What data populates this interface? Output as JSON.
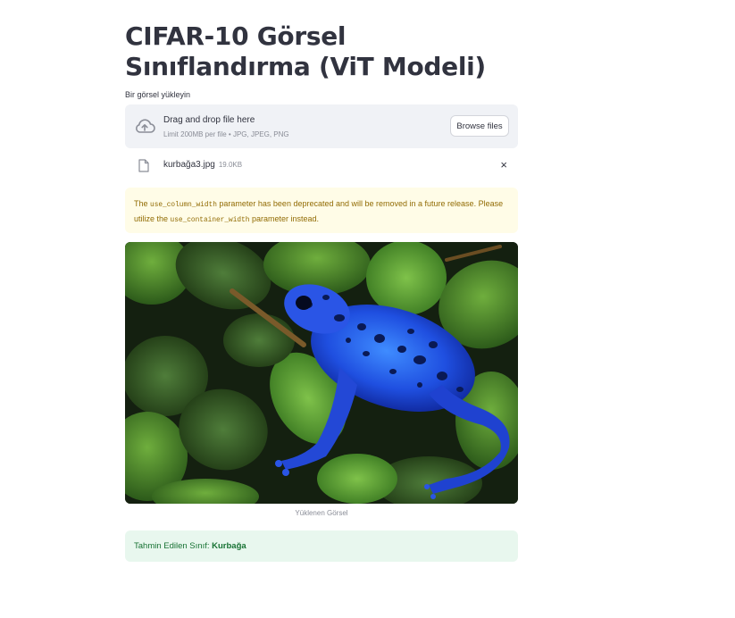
{
  "page": {
    "title": "CIFAR-10 Görsel Sınıflandırma (ViT Modeli)"
  },
  "uploader": {
    "label": "Bir görsel yükleyin",
    "drop_title": "Drag and drop file here",
    "drop_subtitle": "Limit 200MB per file • JPG, JPEG, PNG",
    "browse_label": "Browse files",
    "icon": "cloud-upload-icon"
  },
  "uploaded_file": {
    "name": "kurbağa3.jpg",
    "size": "19.0KB",
    "icon": "file-icon",
    "remove_label": "×"
  },
  "warning": {
    "part1": "The ",
    "code1": "use_column_width",
    "part2": " parameter has been deprecated and will be removed in a future release. Please utilize the ",
    "code2": "use_container_width",
    "part3": " parameter instead."
  },
  "image": {
    "caption": "Yüklenen Görsel"
  },
  "result": {
    "label": "Tahmin Edilen Sınıf: ",
    "value": "Kurbağa"
  },
  "colors": {
    "warning_bg": "#fffce7",
    "warning_text": "#926c05",
    "success_bg": "#e8f7ee",
    "success_text": "#177233",
    "dropzone_bg": "#f0f2f6"
  }
}
